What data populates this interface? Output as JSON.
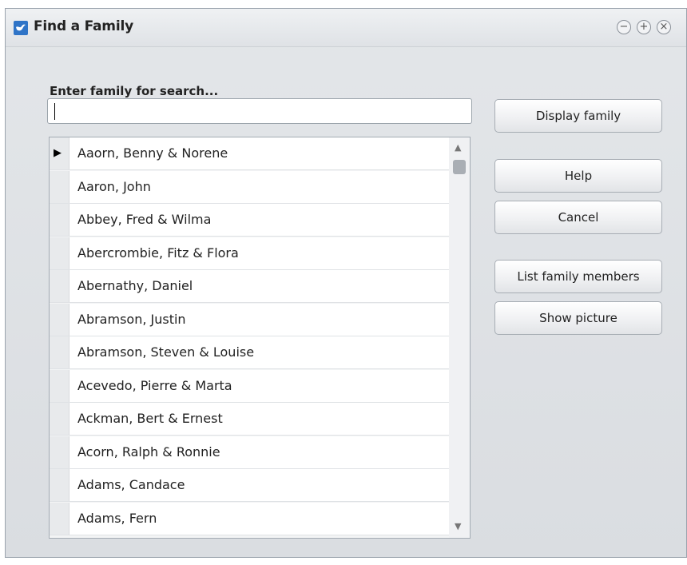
{
  "window": {
    "title": "Find a Family",
    "controls": [
      "minimize-icon",
      "maximize-icon",
      "close-icon"
    ]
  },
  "search": {
    "label": "Enter family for search...",
    "value": ""
  },
  "family_list": {
    "selected_index": 0,
    "items": [
      "Aaorn, Benny & Norene",
      "Aaron, John",
      "Abbey, Fred & Wilma",
      "Abercrombie, Fitz & Flora",
      "Abernathy, Daniel",
      "Abramson, Justin",
      "Abramson, Steven & Louise",
      "Acevedo, Pierre & Marta",
      "Ackman, Bert & Ernest",
      "Acorn, Ralph & Ronnie",
      "Adams, Candace",
      "Adams, Fern"
    ]
  },
  "buttons": {
    "display_family": "Display family",
    "help": "Help",
    "cancel": "Cancel",
    "list_family_members": "List family members",
    "show_picture": "Show picture"
  }
}
